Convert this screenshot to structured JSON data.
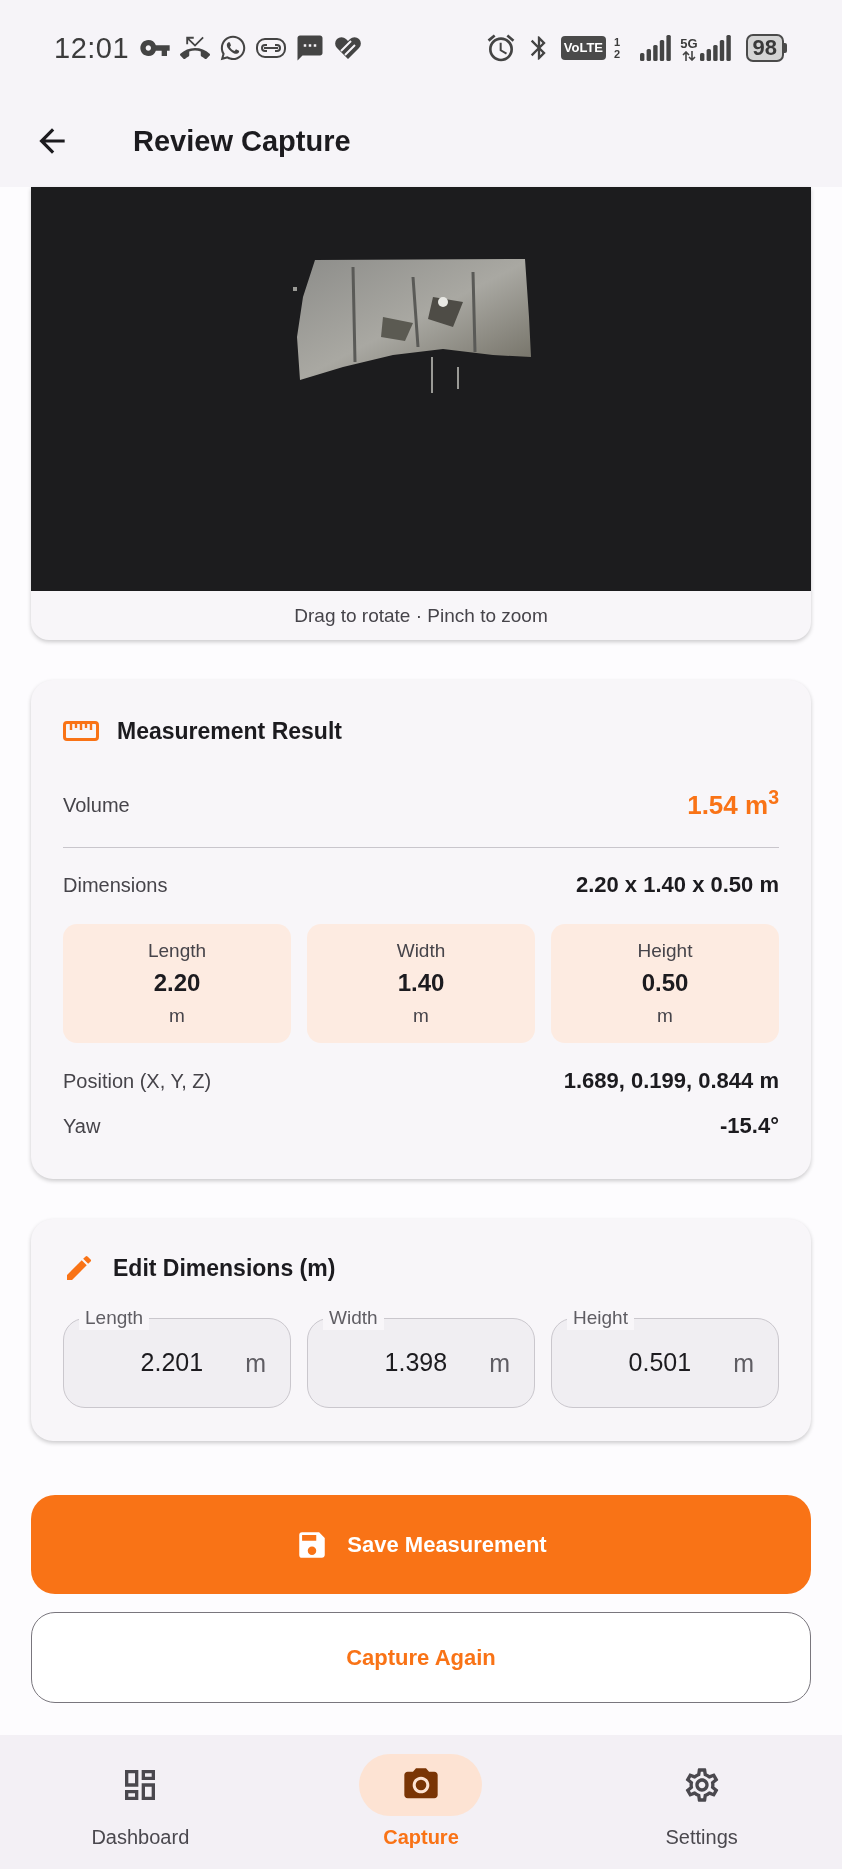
{
  "status_bar": {
    "time": "12:01",
    "volte": "VoLTE",
    "sim_slots": [
      "1",
      "2"
    ],
    "network": "5G",
    "battery": "98"
  },
  "header": {
    "title": "Review Capture"
  },
  "viewer": {
    "hint": "Drag to rotate · Pinch to zoom"
  },
  "result": {
    "title": "Measurement Result",
    "volume": {
      "label": "Volume",
      "value": "1.54 m$^{3}$"
    },
    "dimensions": {
      "label": "Dimensions",
      "value": "2.20 x 1.40 x 0.50 m"
    },
    "tiles": [
      {
        "label": "Length",
        "value": "2.20",
        "unit": "m"
      },
      {
        "label": "Width",
        "value": "1.40",
        "unit": "m"
      },
      {
        "label": "Height",
        "value": "0.50",
        "unit": "m"
      }
    ],
    "details": [
      {
        "label": "Position (X, Y, Z)",
        "value": "1.689, 0.199, 0.844 m"
      },
      {
        "label": "Yaw",
        "value": "-15.4°"
      }
    ]
  },
  "edit": {
    "title": "Edit Dimensions (m)",
    "fields": [
      {
        "label": "Length",
        "value": "2.201",
        "unit": "m"
      },
      {
        "label": "Width",
        "value": "1.398",
        "unit": "m"
      },
      {
        "label": "Height",
        "value": "0.501",
        "unit": "m"
      }
    ]
  },
  "actions": [
    {
      "kind": "primary",
      "label": "Save Measurement"
    },
    {
      "kind": "outline",
      "label": "Capture Again"
    }
  ],
  "nav": [
    {
      "label": "Dashboard",
      "selected": false
    },
    {
      "label": "Capture",
      "selected": true
    },
    {
      "label": "Settings",
      "selected": false
    }
  ]
}
